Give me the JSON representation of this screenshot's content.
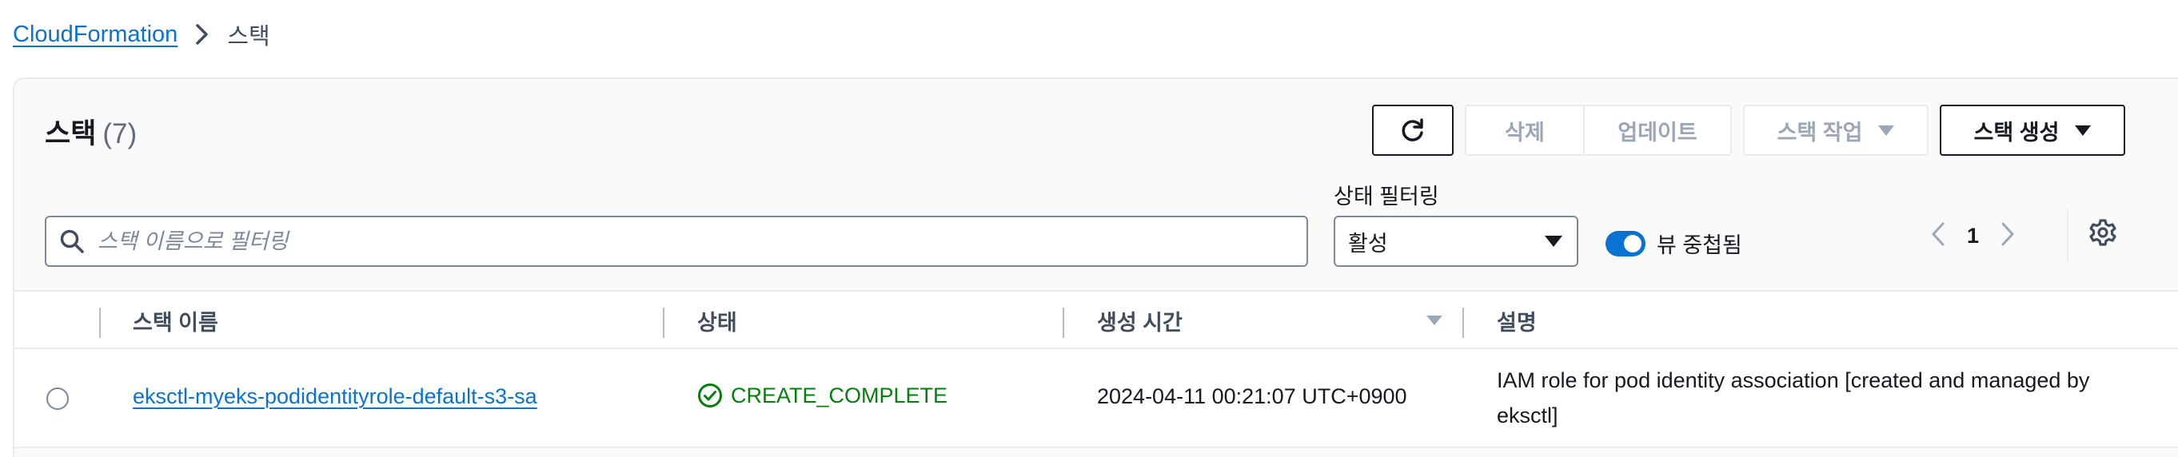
{
  "breadcrumb": {
    "root": "CloudFormation",
    "current": "스택"
  },
  "panel": {
    "title": "스택",
    "count": "(7)"
  },
  "toolbar": {
    "refresh_icon": "refresh-icon",
    "delete_label": "삭제",
    "update_label": "업데이트",
    "actions_label": "스택 작업",
    "create_label": "스택 생성"
  },
  "filters": {
    "search_placeholder": "스택 이름으로 필터링",
    "search_value": "",
    "status_label": "상태 필터링",
    "status_value": "활성",
    "nested_label": "뷰 중첩됨",
    "nested_enabled": true
  },
  "pagination": {
    "current_page": "1"
  },
  "table": {
    "columns": [
      "스택 이름",
      "상태",
      "생성 시간",
      "설명"
    ],
    "rows": [
      {
        "name": "eksctl-myeks-podidentityrole-default-s3-sa",
        "status": "CREATE_COMPLETE",
        "created": "2024-04-11 00:21:07 UTC+0900",
        "description": "IAM role for pod identity association [created and managed by eksctl]"
      }
    ]
  },
  "colors": {
    "accent": "#0972d3",
    "success": "#037f0c",
    "text": "#16191f",
    "disabled": "#9ba7b6"
  }
}
